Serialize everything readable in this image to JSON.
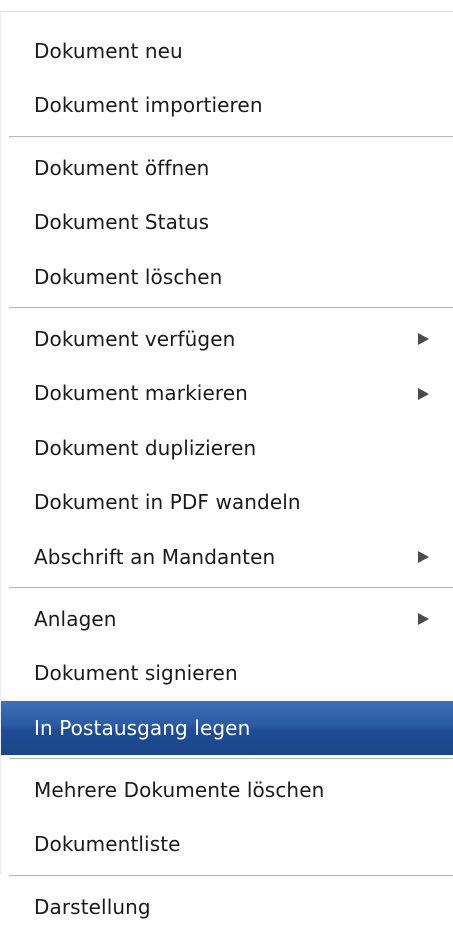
{
  "context_menu": {
    "groups": [
      {
        "items": [
          {
            "label": "Dokument neu",
            "submenu": false
          },
          {
            "label": "Dokument importieren",
            "submenu": false
          }
        ]
      },
      {
        "items": [
          {
            "label": "Dokument öffnen",
            "submenu": false
          },
          {
            "label": "Dokument Status",
            "submenu": false
          },
          {
            "label": "Dokument löschen",
            "submenu": false
          }
        ]
      },
      {
        "items": [
          {
            "label": "Dokument verfügen",
            "submenu": true
          },
          {
            "label": "Dokument markieren",
            "submenu": true
          },
          {
            "label": "Dokument duplizieren",
            "submenu": false
          },
          {
            "label": "Dokument in PDF wandeln",
            "submenu": false
          },
          {
            "label": "Abschrift an Mandanten",
            "submenu": true
          }
        ]
      },
      {
        "items": [
          {
            "label": "Anlagen",
            "submenu": true
          },
          {
            "label": "Dokument signieren",
            "submenu": false
          },
          {
            "label": "In Postausgang legen",
            "submenu": false,
            "highlighted": true
          }
        ]
      },
      {
        "items": [
          {
            "label": "Mehrere Dokumente löschen",
            "submenu": false
          },
          {
            "label": "Dokumentliste",
            "submenu": false
          }
        ]
      },
      {
        "items": [
          {
            "label": "Darstellung",
            "submenu": false
          }
        ]
      }
    ],
    "highlight_color": "#2a5aa3"
  }
}
